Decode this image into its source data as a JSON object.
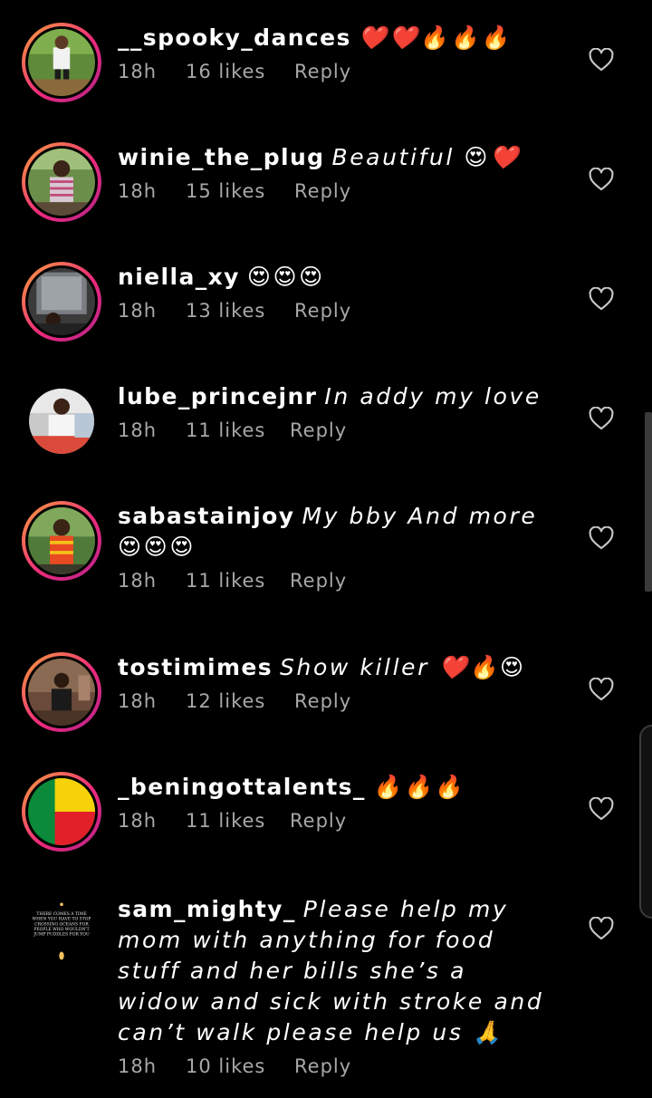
{
  "comments": [
    {
      "username": "__spooky_dances",
      "text": "❤️❤️🔥🔥🔥",
      "time": "18h",
      "likes": "16 likes",
      "reply": "Reply"
    },
    {
      "username": "winie_the_plug",
      "text": "Beautiful 😍❤️",
      "time": "18h",
      "likes": "15 likes",
      "reply": "Reply"
    },
    {
      "username": "niella_xy",
      "text": "😍😍😍",
      "time": "18h",
      "likes": "13 likes",
      "reply": "Reply"
    },
    {
      "username": "lube_princejnr",
      "text": "In addy my love",
      "time": "18h",
      "likes": "11 likes",
      "reply": "Reply"
    },
    {
      "username": "sabastainjoy",
      "text": "My bby And more 😍😍😍",
      "time": "18h",
      "likes": "11 likes",
      "reply": "Reply"
    },
    {
      "username": "tostimimes",
      "text": "Show killer ❤️🔥😍",
      "time": "18h",
      "likes": "12 likes",
      "reply": "Reply"
    },
    {
      "username": "_beningottalents_",
      "text": "🔥🔥🔥",
      "time": "18h",
      "likes": "11 likes",
      "reply": "Reply"
    },
    {
      "username": "sam_mighty_",
      "text": "Please help my mom with anything for food stuff and her bills she’s a widow and sick with stroke and can’t walk please help us 🙏",
      "time": "18h",
      "likes": "10 likes",
      "reply": "Reply"
    }
  ],
  "avatar_quote": "THERE COMES A TIME WHEN YOU HAVE TO STOP CROSSING OCEANS FOR PEOPLE WHO WOULDN'T JUMP PUDDLES FOR YOU",
  "colors": {
    "background": "#000000",
    "meta_text": "#a8a8a8",
    "ring_start": "#f9a23a",
    "ring_end": "#b3238a"
  },
  "icons": {
    "like": "heart-outline-icon"
  }
}
